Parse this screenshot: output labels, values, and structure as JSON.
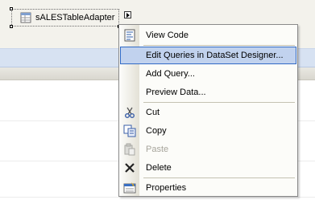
{
  "component": {
    "name": "sALESTableAdapter",
    "icon": "table-adapter-icon"
  },
  "context_menu": {
    "items": [
      {
        "label": "View Code",
        "icon": "view-code-icon",
        "enabled": true,
        "highlighted": false
      },
      {
        "label": "Edit Queries in DataSet Designer...",
        "icon": "",
        "enabled": true,
        "highlighted": true
      },
      {
        "label": "Add Query...",
        "icon": "",
        "enabled": true,
        "highlighted": false
      },
      {
        "label": "Preview Data...",
        "icon": "",
        "enabled": true,
        "highlighted": false
      },
      {
        "label": "Cut",
        "icon": "scissors-icon",
        "enabled": true,
        "highlighted": false
      },
      {
        "label": "Copy",
        "icon": "copy-icon",
        "enabled": true,
        "highlighted": false
      },
      {
        "label": "Paste",
        "icon": "paste-icon",
        "enabled": false,
        "highlighted": false
      },
      {
        "label": "Delete",
        "icon": "delete-x-icon",
        "enabled": true,
        "highlighted": false
      },
      {
        "label": "Properties",
        "icon": "properties-icon",
        "enabled": true,
        "highlighted": false
      }
    ]
  },
  "colors": {
    "highlight": "#c1d2ee",
    "highlight_border": "#316ac5",
    "disabled_text": "#a7a59c"
  }
}
